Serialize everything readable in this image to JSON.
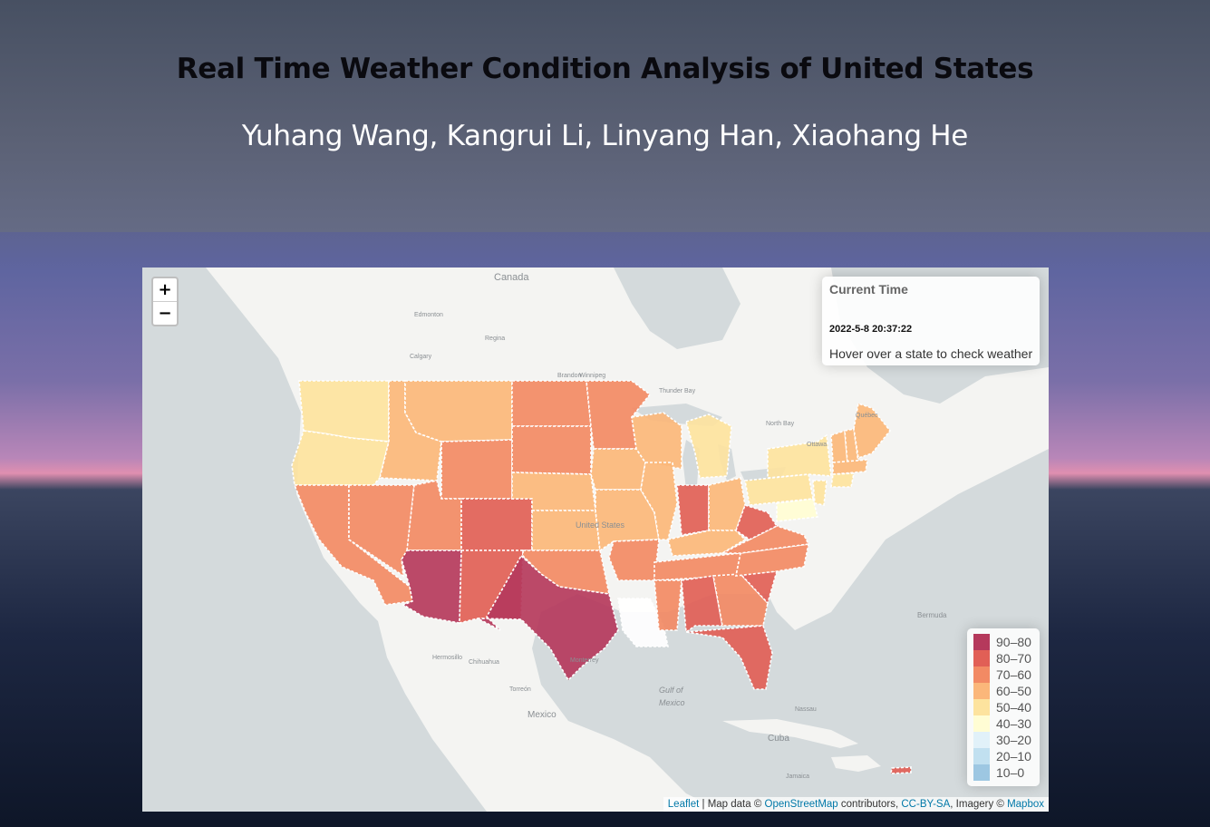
{
  "header": {
    "title": "Real Time Weather Condition Analysis of United States",
    "authors": "Yuhang Wang, Kangrui Li, Linyang Han, Xiaohang He"
  },
  "map": {
    "zoom_in": "+",
    "zoom_out": "−",
    "info": {
      "heading": "Current Time",
      "time": "2022-5-8 20:37:22",
      "message": "Hover over a state to check weather"
    },
    "legend": [
      {
        "label": "90–80",
        "color": "#b5395c"
      },
      {
        "label": "80–70",
        "color": "#e15f56"
      },
      {
        "label": "70–60",
        "color": "#f28a64"
      },
      {
        "label": "60–50",
        "color": "#fbb77a"
      },
      {
        "label": "50–40",
        "color": "#fde39e"
      },
      {
        "label": "40–30",
        "color": "#fffdd4"
      },
      {
        "label": "30–20",
        "color": "#e1f1f9"
      },
      {
        "label": "20–10",
        "color": "#c1e0f0"
      },
      {
        "label": "10–0",
        "color": "#9dc7e2"
      }
    ],
    "place_labels": {
      "canada": "Canada",
      "united_states": "United States",
      "mexico": "Mexico",
      "cuba": "Cuba",
      "gulf": "Gulf of",
      "gulf2": "Mexico",
      "bermuda": "Bermuda",
      "edmonton": "Edmonton",
      "calgary": "Calgary",
      "regina": "Regina",
      "winnipeg": "Winnipeg",
      "ottawa": "Ottawa",
      "quebec": "Québec",
      "north_bay": "North Bay",
      "thunder_bay": "Thunder Bay",
      "brandon": "Brandon",
      "monterrey": "Monterrey",
      "chihuahua": "Chihuahua",
      "torreon": "Torreón",
      "hermosillo": "Hermosillo",
      "nassau": "Nassau",
      "jamaica": "Jamaica"
    },
    "attribution": {
      "leaflet": "Leaflet",
      "text1": " | Map data © ",
      "osm": "OpenStreetMap",
      "text2": " contributors, ",
      "ccbysa": "CC-BY-SA",
      "text3": ", Imagery © ",
      "mapbox": "Mapbox"
    },
    "states": [
      {
        "name": "Washington",
        "color": "#fde39e"
      },
      {
        "name": "Oregon",
        "color": "#fde39e"
      },
      {
        "name": "California",
        "color": "#f28a64"
      },
      {
        "name": "Idaho",
        "color": "#fbb77a"
      },
      {
        "name": "Nevada",
        "color": "#f28a64"
      },
      {
        "name": "Montana",
        "color": "#fbb77a"
      },
      {
        "name": "Wyoming",
        "color": "#f28a64"
      },
      {
        "name": "Utah",
        "color": "#f28a64"
      },
      {
        "name": "Arizona",
        "color": "#b5395c"
      },
      {
        "name": "Colorado",
        "color": "#e15f56"
      },
      {
        "name": "New Mexico",
        "color": "#e15f56"
      },
      {
        "name": "North Dakota",
        "color": "#f28a64"
      },
      {
        "name": "South Dakota",
        "color": "#f28a64"
      },
      {
        "name": "Nebraska",
        "color": "#fbb77a"
      },
      {
        "name": "Kansas",
        "color": "#fbb77a"
      },
      {
        "name": "Oklahoma",
        "color": "#f28a64"
      },
      {
        "name": "Texas",
        "color": "#b5395c"
      },
      {
        "name": "Minnesota",
        "color": "#f28a64"
      },
      {
        "name": "Iowa",
        "color": "#fbb77a"
      },
      {
        "name": "Missouri",
        "color": "#fbb77a"
      },
      {
        "name": "Arkansas",
        "color": "#f28a64"
      },
      {
        "name": "Louisiana",
        "color": "#ffffff"
      },
      {
        "name": "Wisconsin",
        "color": "#fbb77a"
      },
      {
        "name": "Illinois",
        "color": "#fbb77a"
      },
      {
        "name": "Michigan",
        "color": "#fde39e"
      },
      {
        "name": "Indiana",
        "color": "#e15f56"
      },
      {
        "name": "Ohio",
        "color": "#fbb77a"
      },
      {
        "name": "Kentucky",
        "color": "#fbb77a"
      },
      {
        "name": "Tennessee",
        "color": "#f28a64"
      },
      {
        "name": "Mississippi",
        "color": "#f28a64"
      },
      {
        "name": "Alabama",
        "color": "#e15f56"
      },
      {
        "name": "Georgia",
        "color": "#f28a64"
      },
      {
        "name": "Florida",
        "color": "#e15f56"
      },
      {
        "name": "South Carolina",
        "color": "#e15f56"
      },
      {
        "name": "North Carolina",
        "color": "#f28a64"
      },
      {
        "name": "Virginia",
        "color": "#f28a64"
      },
      {
        "name": "West Virginia",
        "color": "#e15f56"
      },
      {
        "name": "Pennsylvania",
        "color": "#fde39e"
      },
      {
        "name": "New York",
        "color": "#fde39e"
      },
      {
        "name": "Maryland",
        "color": "#fffdd4"
      },
      {
        "name": "New Jersey",
        "color": "#fde39e"
      },
      {
        "name": "Vermont",
        "color": "#fbb77a"
      },
      {
        "name": "New Hampshire",
        "color": "#fbb77a"
      },
      {
        "name": "Maine",
        "color": "#fbb77a"
      },
      {
        "name": "Massachusetts",
        "color": "#fbb77a"
      },
      {
        "name": "Connecticut",
        "color": "#fde39e"
      },
      {
        "name": "Puerto Rico",
        "color": "#e15f56"
      }
    ]
  }
}
